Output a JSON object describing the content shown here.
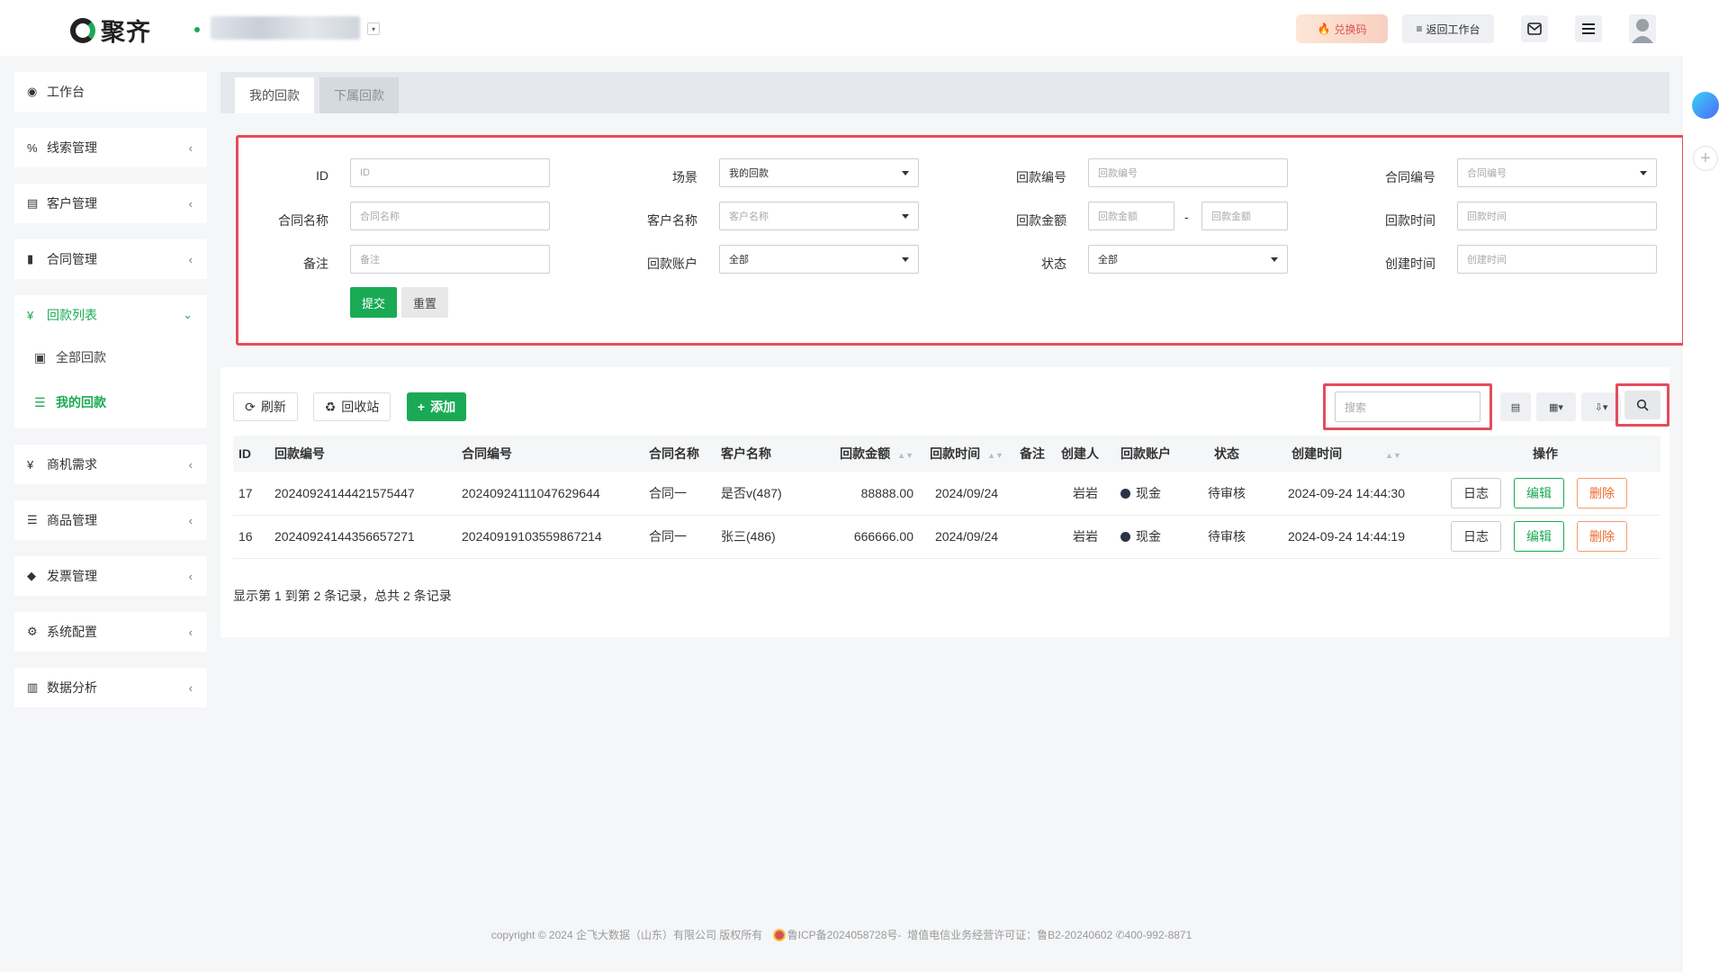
{
  "brand": {
    "name": "聚齐"
  },
  "header": {
    "redeem_label": "兑换码",
    "back_label": "返回工作台"
  },
  "sidebar": {
    "items": [
      {
        "label": "工作台",
        "icon": "dashboard-icon"
      },
      {
        "label": "线索管理",
        "icon": "link-icon"
      },
      {
        "label": "客户管理",
        "icon": "id-card-icon"
      },
      {
        "label": "合同管理",
        "icon": "bookmark-icon"
      },
      {
        "label": "回款列表",
        "icon": "yen-icon"
      },
      {
        "label": "商机需求",
        "icon": "yen-icon"
      },
      {
        "label": "商品管理",
        "icon": "list-icon"
      },
      {
        "label": "发票管理",
        "icon": "tag-icon"
      },
      {
        "label": "系统配置",
        "icon": "gears-icon"
      },
      {
        "label": "数据分析",
        "icon": "bar-chart-icon"
      }
    ],
    "sub_items": [
      {
        "label": "全部回款"
      },
      {
        "label": "我的回款"
      }
    ]
  },
  "tabs": [
    {
      "label": "我的回款",
      "active": true
    },
    {
      "label": "下属回款",
      "active": false
    }
  ],
  "filters": {
    "id": {
      "label": "ID",
      "placeholder": "ID"
    },
    "scene": {
      "label": "场景",
      "value": "我的回款"
    },
    "payment_no": {
      "label": "回款编号",
      "placeholder": "回款编号"
    },
    "contract_no": {
      "label": "合同编号",
      "placeholder": "合同编号"
    },
    "contract_name": {
      "label": "合同名称",
      "placeholder": "合同名称"
    },
    "customer_name": {
      "label": "客户名称",
      "placeholder": "客户名称"
    },
    "amount": {
      "label": "回款金额",
      "placeholder_min": "回款金额",
      "placeholder_max": "回款金额",
      "separator": "-"
    },
    "payment_time": {
      "label": "回款时间",
      "placeholder": "回款时间"
    },
    "remark": {
      "label": "备注",
      "placeholder": "备注"
    },
    "account": {
      "label": "回款账户",
      "value": "全部"
    },
    "status": {
      "label": "状态",
      "value": "全部"
    },
    "created_time": {
      "label": "创建时间",
      "placeholder": "创建时间"
    },
    "submit_label": "提交",
    "reset_label": "重置"
  },
  "toolbar": {
    "refresh_label": "刷新",
    "recycle_label": "回收站",
    "add_label": "添加",
    "search_placeholder": "搜索"
  },
  "table": {
    "headers": [
      "ID",
      "回款编号",
      "合同编号",
      "合同名称",
      "客户名称",
      "回款金额",
      "回款时间",
      "备注",
      "创建人",
      "回款账户",
      "状态",
      "创建时间",
      "操作"
    ],
    "rows": [
      {
        "id": "17",
        "payment_no": "20240924144421575447",
        "contract_no": "20240924111047629644",
        "contract_name": "合同一",
        "customer_name": "是否v(487)",
        "amount": "88888.00",
        "payment_time": "2024/09/24",
        "remark": "",
        "creator": "岩岩",
        "account": "现金",
        "status": "待审核",
        "created_time": "2024-09-24 14:44:30"
      },
      {
        "id": "16",
        "payment_no": "20240924144356657271",
        "contract_no": "20240919103559867214",
        "contract_name": "合同一",
        "customer_name": "张三(486)",
        "amount": "666666.00",
        "payment_time": "2024/09/24",
        "remark": "",
        "creator": "岩岩",
        "account": "现金",
        "status": "待审核",
        "created_time": "2024-09-24 14:44:19"
      }
    ],
    "actions": {
      "log": "日志",
      "edit": "编辑",
      "delete": "删除"
    },
    "summary": "显示第 1 到第 2 条记录，总共 2 条记录"
  },
  "footer": {
    "copyright": "copyright © 2024 企飞大数据（山东）有限公司 版权所有",
    "icp": "鲁ICP备2024058728号-",
    "license": "增值电信业务经营许可证：鲁B2-20240602",
    "phone": "400-992-8871"
  },
  "colors": {
    "accent": "#1aaa55",
    "highlight": "#e34d5d",
    "delete": "#f0692c"
  }
}
